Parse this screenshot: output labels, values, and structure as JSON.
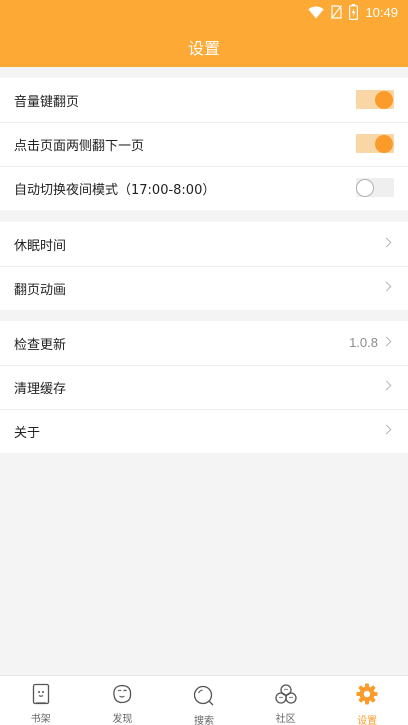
{
  "status_bar": {
    "time": "10:49"
  },
  "appbar": {
    "title": "设置"
  },
  "groups": {
    "reading": {
      "volume_key": {
        "label": "音量键翻页",
        "enabled": true
      },
      "tap_sides": {
        "label": "点击页面两侧翻下一页",
        "enabled": true
      },
      "auto_night": {
        "label": "自动切换夜间模式（17:00-8:00）",
        "enabled": false
      }
    },
    "general": {
      "sleep_time": {
        "label": "休眠时间"
      },
      "page_anim": {
        "label": "翻页动画"
      }
    },
    "about": {
      "check_update": {
        "label": "检查更新",
        "value": "1.0.8"
      },
      "clear_cache": {
        "label": "清理缓存"
      },
      "about_app": {
        "label": "关于"
      }
    }
  },
  "tabbar": {
    "bookshelf": {
      "label": "书架",
      "icon": "bookshelf-icon"
    },
    "discover": {
      "label": "发现",
      "icon": "discover-face-icon"
    },
    "search": {
      "label": "搜索",
      "icon": "search-icon"
    },
    "community": {
      "label": "社区",
      "icon": "community-icon"
    },
    "settings": {
      "label": "设置",
      "icon": "gear-icon",
      "active": true
    }
  },
  "colors": {
    "accent": "#fda935",
    "toggle_on": "#fb9b2a",
    "toggle_track_on": "#f8d6a6"
  }
}
